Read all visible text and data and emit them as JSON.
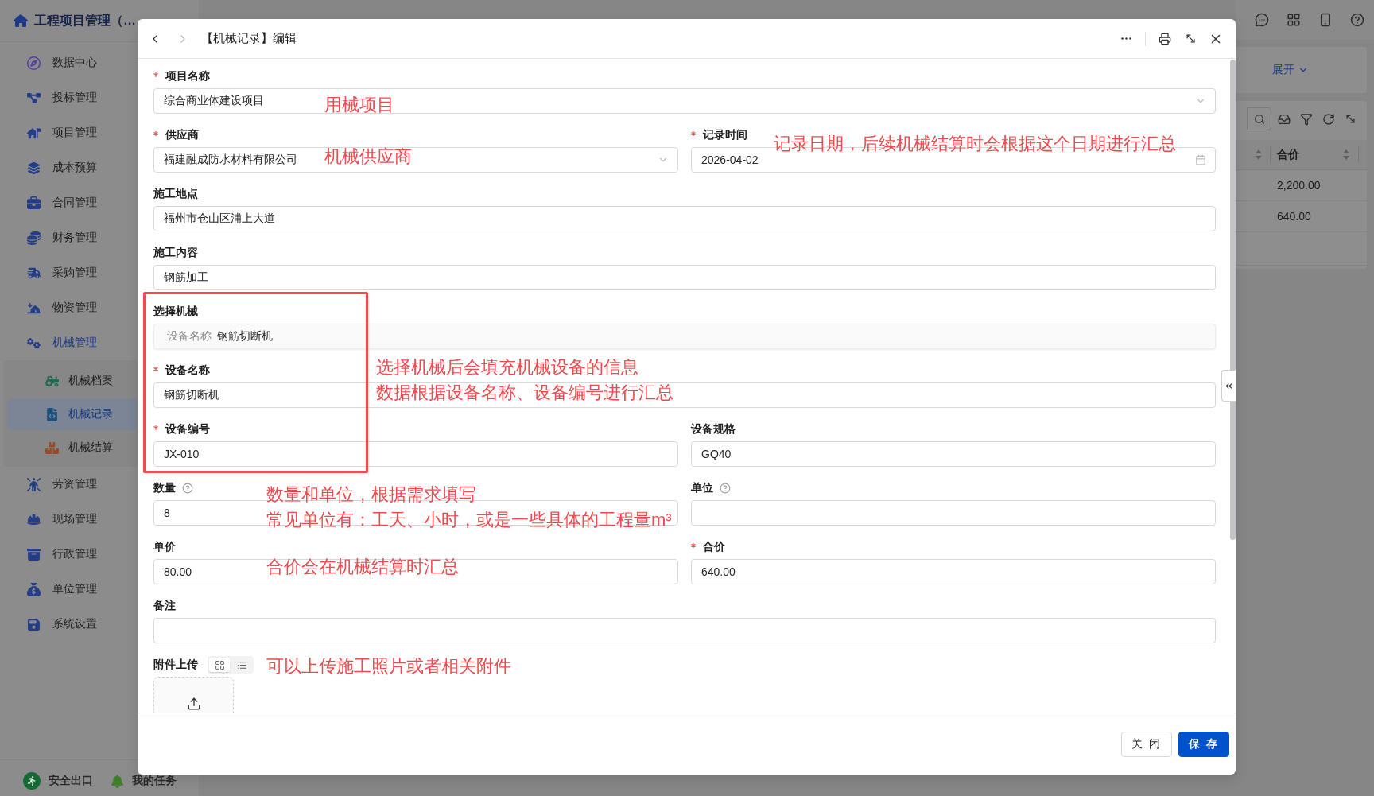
{
  "sidebar": {
    "title": "工程项目管理（…",
    "items": [
      {
        "label": "数据中心",
        "selected": false
      },
      {
        "label": "投标管理",
        "selected": false
      },
      {
        "label": "项目管理",
        "selected": false
      },
      {
        "label": "成本预算",
        "selected": false
      },
      {
        "label": "合同管理",
        "selected": false
      },
      {
        "label": "财务管理",
        "selected": false
      },
      {
        "label": "采购管理",
        "selected": false
      },
      {
        "label": "物资管理",
        "selected": false
      },
      {
        "label": "机械管理",
        "expanded": true,
        "children": [
          {
            "label": "机械档案",
            "selected": false
          },
          {
            "label": "机械记录",
            "selected": true
          },
          {
            "label": "机械结算",
            "selected": false
          }
        ]
      },
      {
        "label": "劳资管理",
        "selected": false
      },
      {
        "label": "现场管理",
        "selected": false
      },
      {
        "label": "行政管理",
        "selected": false
      },
      {
        "label": "单位管理",
        "selected": false
      },
      {
        "label": "系统设置",
        "selected": false
      }
    ],
    "footer": [
      {
        "label": "安全出口"
      },
      {
        "label": "我的任务"
      }
    ]
  },
  "filter": {
    "expand_link": "展开"
  },
  "table": {
    "columns": [
      {
        "label": "合价",
        "sortable": true
      }
    ],
    "rows": [
      [
        "2,200.00"
      ],
      [
        "640.00"
      ]
    ]
  },
  "dialog": {
    "title": "【机械记录】编辑",
    "nav": [
      {
        "kind": "back",
        "disabled": false
      },
      {
        "kind": "forward",
        "disabled": true
      }
    ],
    "form": {
      "rows": [
        [
          {
            "kind": "select",
            "label": "项目名称",
            "required": true,
            "value": "综合商业体建设项目"
          }
        ],
        [
          {
            "kind": "select",
            "label": "供应商",
            "required": true,
            "value": "福建融成防水材料有限公司"
          },
          {
            "kind": "date",
            "label": "记录时间",
            "required": true,
            "value": "2026-04-02"
          }
        ],
        [
          {
            "kind": "text",
            "label": "施工地点",
            "required": false,
            "value": "福州市仓山区浦上大道"
          }
        ],
        [
          {
            "kind": "text",
            "label": "施工内容",
            "required": false,
            "value": "钢筋加工"
          }
        ],
        [
          {
            "kind": "picker",
            "label": "选择机械",
            "required": false,
            "prefix": "设备名称",
            "value": "钢筋切断机"
          }
        ],
        [
          {
            "kind": "text",
            "label": "设备名称",
            "required": true,
            "value": "钢筋切断机"
          }
        ],
        [
          {
            "kind": "text",
            "label": "设备编号",
            "required": true,
            "value": "JX-010"
          },
          {
            "kind": "text",
            "label": "设备规格",
            "required": false,
            "value": "GQ40"
          }
        ],
        [
          {
            "kind": "text",
            "label": "数量",
            "required": false,
            "help": true,
            "value": "8"
          },
          {
            "kind": "text",
            "label": "单位",
            "required": false,
            "help": true
          }
        ],
        [
          {
            "kind": "text",
            "label": "单价",
            "required": false,
            "value": "80.00"
          },
          {
            "kind": "text",
            "label": "合价",
            "required": true,
            "value": "640.00"
          }
        ],
        [
          {
            "kind": "text",
            "label": "备注",
            "required": false
          }
        ],
        [
          {
            "kind": "upload",
            "label": "附件上传",
            "required": false,
            "views": [
              {
                "kind": "grid",
                "selected": true
              },
              {
                "kind": "list",
                "selected": false
              }
            ]
          }
        ]
      ]
    },
    "buttons": [
      {
        "label": "关 闭",
        "kind": "default"
      },
      {
        "label": "保 存",
        "kind": "primary"
      }
    ]
  },
  "annotations": [
    {
      "lines": [
        "用械项目"
      ]
    },
    {
      "lines": [
        "机械供应商"
      ]
    },
    {
      "lines": [
        "记录日期，后续机械结算时会根据这个日期进行汇总"
      ]
    },
    {
      "lines": [
        "选择机械后会填充机械设备的信息",
        "数据根据设备名称、设备编号进行汇总"
      ]
    },
    {
      "lines": [
        "数量和单位，根据需求填写",
        "常见单位有：工天、小时，或是一些具体的工程量m³"
      ]
    },
    {
      "lines": [
        "合价会在机械结算时汇总"
      ]
    },
    {
      "lines": [
        "可以上传施工照片或者相关附件"
      ]
    }
  ]
}
